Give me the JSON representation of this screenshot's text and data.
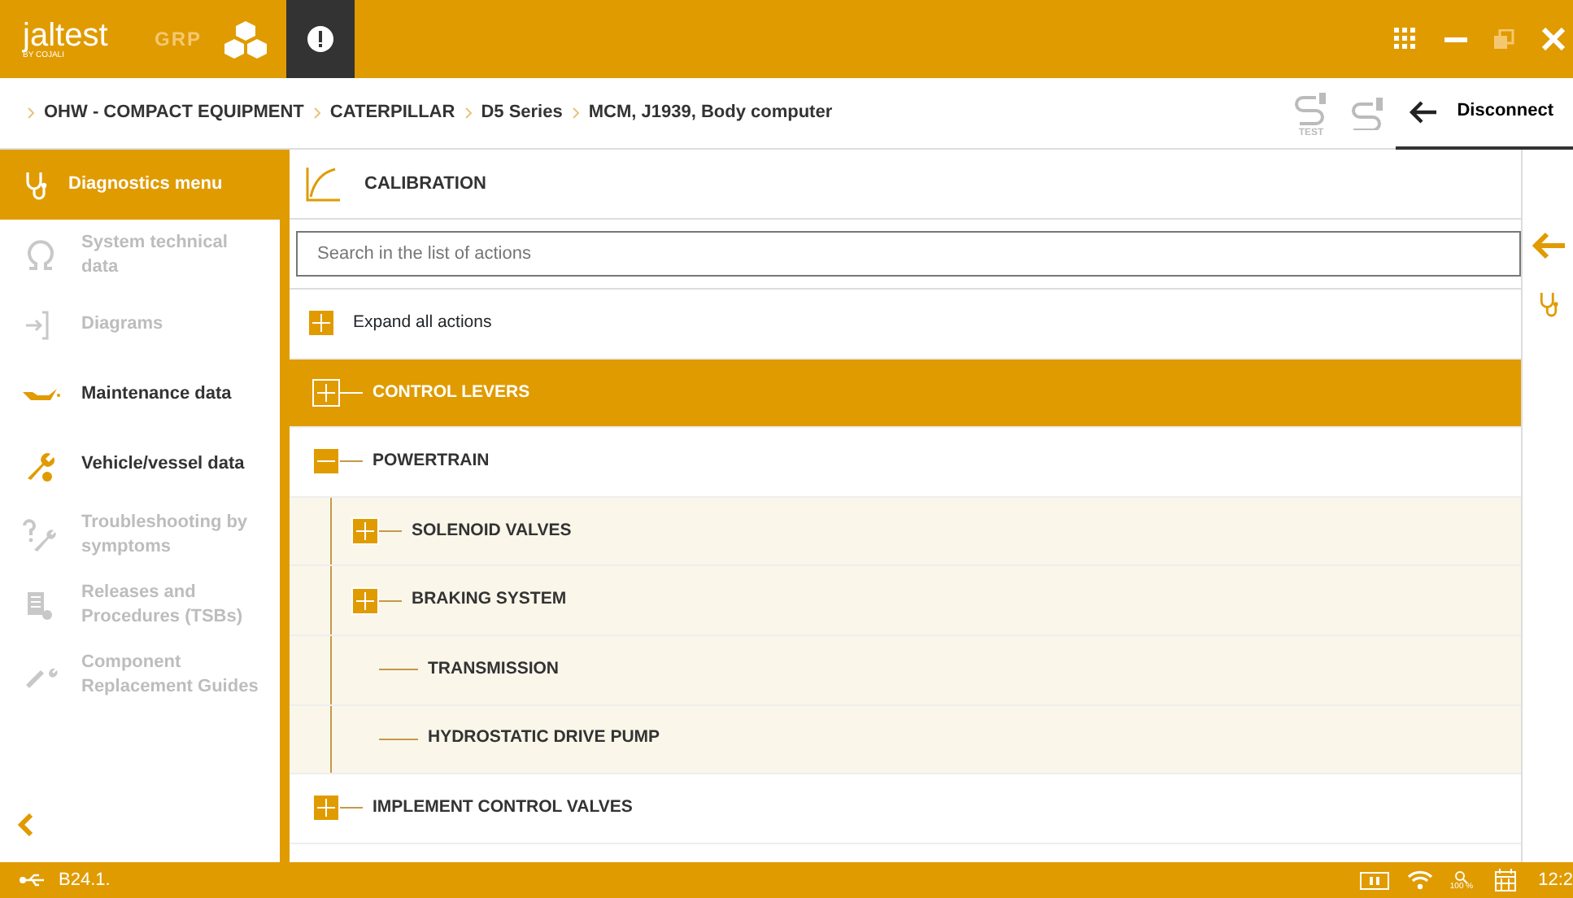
{
  "top_bar": {
    "logo": "jaltest",
    "logo_sub": "BY COJALI",
    "product": "GRP"
  },
  "breadcrumb": [
    "OHW - COMPACT EQUIPMENT",
    "CATERPILLAR",
    "D5 Series",
    "MCM, J1939, Body computer"
  ],
  "disconnect": {
    "label": "Disconnect",
    "test_label": "TEST"
  },
  "sidebar": {
    "title": "Diagnostics menu",
    "items": [
      {
        "label": "System technical data",
        "disabled": true
      },
      {
        "label": "Diagrams",
        "disabled": true
      },
      {
        "label": "Maintenance data",
        "disabled": false
      },
      {
        "label": "Vehicle/vessel data",
        "disabled": false
      },
      {
        "label": "Troubleshooting by symptoms",
        "disabled": true
      },
      {
        "label": "Releases and Procedures (TSBs)",
        "disabled": true
      },
      {
        "label": "Component Replacement Guides",
        "disabled": true
      }
    ]
  },
  "panel": {
    "title": "CALIBRATION",
    "search": {
      "placeholder": "Search in the list of actions"
    },
    "expand_all": "Expand all actions",
    "tree": [
      {
        "label": "CONTROL LEVERS",
        "kind": "group",
        "expanded": false,
        "selected": true
      },
      {
        "label": "POWERTRAIN",
        "kind": "group",
        "expanded": true,
        "selected": false,
        "children": [
          {
            "label": "SOLENOID VALVES",
            "kind": "group",
            "expanded": false,
            "selected": false
          },
          {
            "label": "BRAKING SYSTEM",
            "kind": "group",
            "expanded": false,
            "selected": false
          },
          {
            "label": "TRANSMISSION",
            "kind": "action",
            "selected": false
          },
          {
            "label": "HYDROSTATIC DRIVE PUMP",
            "kind": "action",
            "selected": false
          }
        ]
      },
      {
        "label": "IMPLEMENT CONTROL VALVES",
        "kind": "group",
        "expanded": false,
        "selected": false
      }
    ]
  },
  "status_bar": {
    "version": "B24.1.",
    "zoom": "100 %",
    "time": "12:2"
  }
}
